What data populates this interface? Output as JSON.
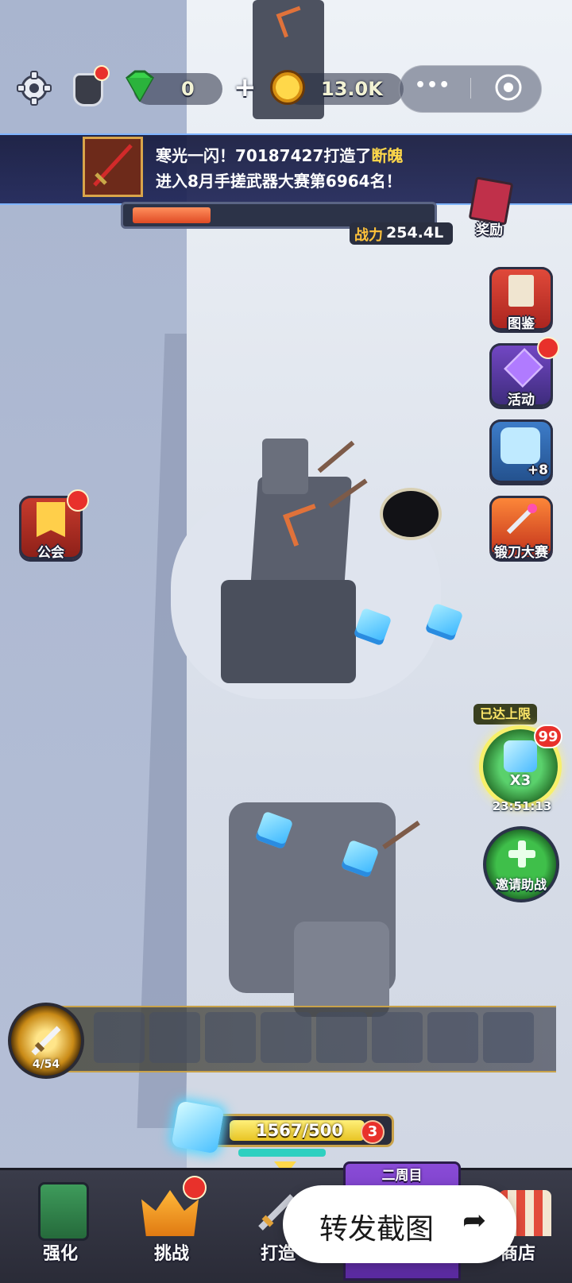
{
  "header": {
    "gems": "0",
    "plus": "+",
    "coins": "13.0K",
    "menu_dots": "•••",
    "icons": [
      "gear-icon",
      "guild-helmet-icon",
      "green-gem-icon",
      "crown-coin-icon",
      "target-icon"
    ]
  },
  "banner": {
    "line1_prefix": "寒光一闪！",
    "line1_player": "70187427",
    "line1_mid": "打造了",
    "line1_item": "断魄",
    "line2": "进入8月手搓武器大赛第6964名！"
  },
  "power": {
    "label": "战力",
    "value": "254.4L",
    "progress": 0.25
  },
  "right_menu": {
    "reward": "奖励",
    "codex": "图鉴",
    "events": "活动",
    "pet_count": "+8",
    "forge_contest": "锻刀大赛",
    "limit_reached": "已达上限",
    "boost_badge": "99",
    "boost_mult": "X3",
    "timer": "23:51:13",
    "invite": "邀请助战"
  },
  "left_menu": {
    "guild": "公会"
  },
  "weapon": {
    "count": "4/54"
  },
  "energy": {
    "value": "1567/500",
    "badge": "3"
  },
  "bottom_nav": {
    "upgrade": "强化",
    "challenge": "挑战",
    "forge": "打造",
    "second_round": "二周目",
    "shop": "商店"
  },
  "share": {
    "label": "转发截图",
    "arrow": "➦"
  },
  "colors": {
    "accent_gold": "#ffd84a",
    "badge_red": "#e8312b",
    "banner_bg": "#1e2456",
    "invite_green": "#2fa83a"
  }
}
